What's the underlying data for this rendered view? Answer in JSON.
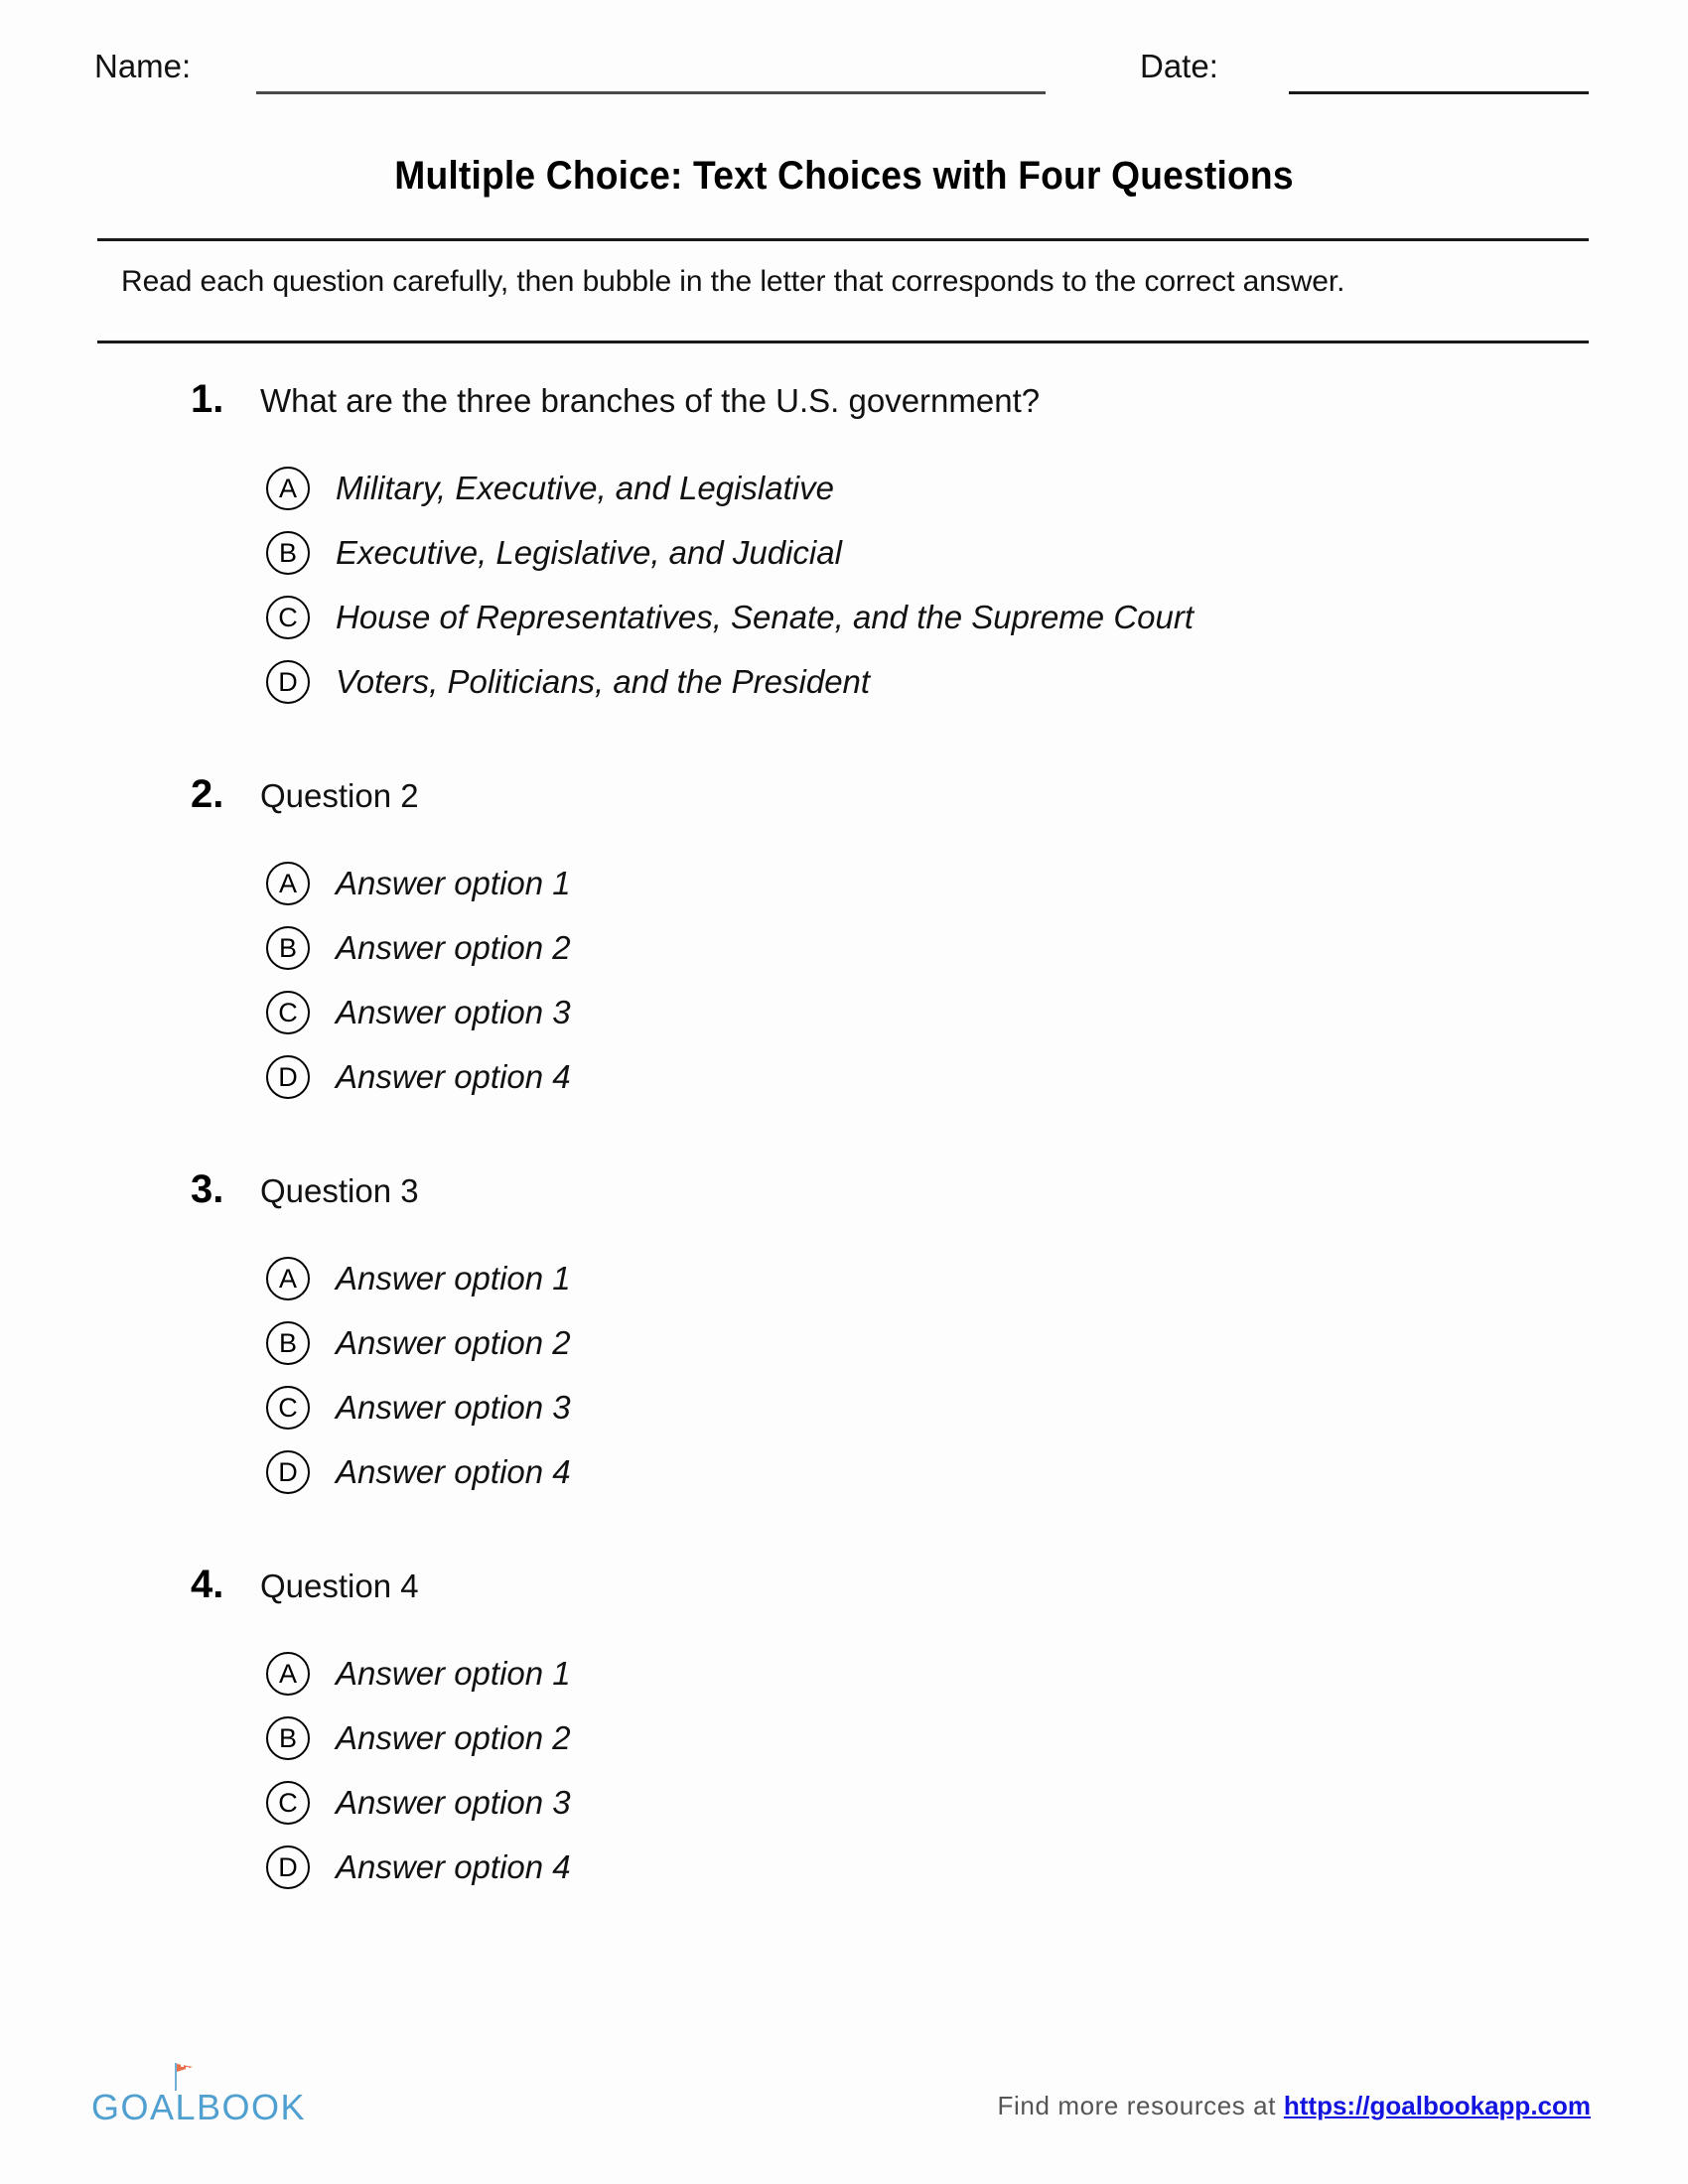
{
  "header": {
    "name_label": "Name:",
    "date_label": "Date:",
    "name_value": "",
    "date_value": ""
  },
  "title": "Multiple Choice: Text Choices with Four Questions",
  "instructions": "Read each question carefully, then bubble in the letter that corresponds to the correct answer.",
  "questions": [
    {
      "number": "1.",
      "text": "What are the three branches of the U.S. government?",
      "options": [
        {
          "letter": "A",
          "text": "Military, Executive, and Legislative"
        },
        {
          "letter": "B",
          "text": "Executive, Legislative, and Judicial"
        },
        {
          "letter": "C",
          "text": "House of Representatives, Senate, and the Supreme Court"
        },
        {
          "letter": "D",
          "text": "Voters, Politicians, and the President"
        }
      ]
    },
    {
      "number": "2.",
      "text": "Question 2",
      "options": [
        {
          "letter": "A",
          "text": "Answer option 1"
        },
        {
          "letter": "B",
          "text": "Answer option 2"
        },
        {
          "letter": "C",
          "text": "Answer option 3"
        },
        {
          "letter": "D",
          "text": "Answer option 4"
        }
      ]
    },
    {
      "number": "3.",
      "text": "Question 3",
      "options": [
        {
          "letter": "A",
          "text": "Answer option 1"
        },
        {
          "letter": "B",
          "text": "Answer option 2"
        },
        {
          "letter": "C",
          "text": "Answer option 3"
        },
        {
          "letter": "D",
          "text": "Answer option 4"
        }
      ]
    },
    {
      "number": "4.",
      "text": "Question 4",
      "options": [
        {
          "letter": "A",
          "text": "Answer option 1"
        },
        {
          "letter": "B",
          "text": "Answer option 2"
        },
        {
          "letter": "C",
          "text": "Answer option 3"
        },
        {
          "letter": "D",
          "text": "Answer option 4"
        }
      ]
    }
  ],
  "footer": {
    "logo_text": "GOALBOOK",
    "logo_color": "#4f9fd0",
    "flag_color": "#e8704a",
    "note_prefix": "Find more resources at ",
    "link_text": "https://goalbookapp.com",
    "link_color": "#1414e0"
  }
}
